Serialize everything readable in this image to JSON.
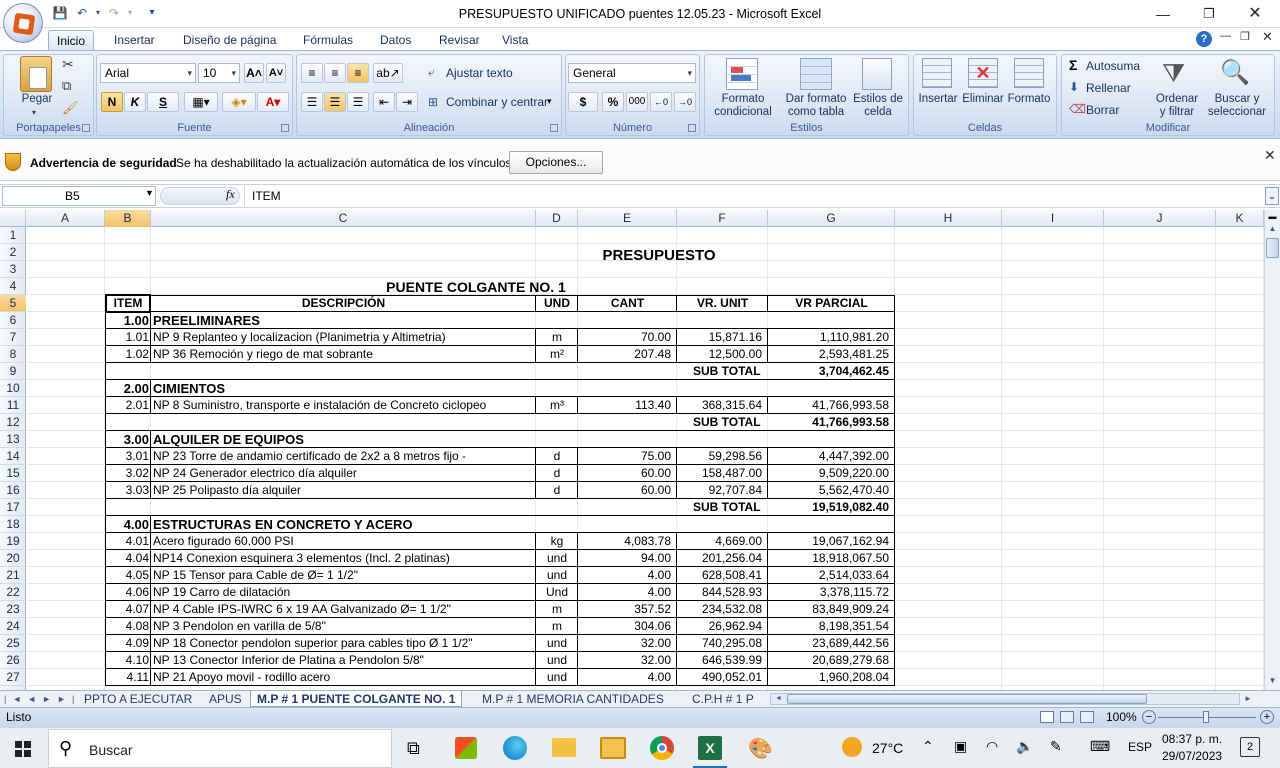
{
  "window": {
    "title": "PRESUPUESTO UNIFICADO puentes 12.05.23 - Microsoft Excel"
  },
  "ribbon": {
    "tabs": [
      "Inicio",
      "Insertar",
      "Diseño de página",
      "Fórmulas",
      "Datos",
      "Revisar",
      "Vista"
    ],
    "active_tab": "Inicio",
    "clipboard": {
      "title": "Portapapeles",
      "paste": "Pegar"
    },
    "font": {
      "title": "Fuente",
      "name": "Arial",
      "size": "10",
      "bold": "N",
      "italic": "K",
      "underline": "S"
    },
    "alignment": {
      "title": "Alineación",
      "wrap": "Ajustar texto",
      "merge": "Combinar y centrar"
    },
    "number": {
      "title": "Número",
      "format": "General",
      "currency": "$",
      "percent": "%",
      "thousands": "000"
    },
    "styles": {
      "title": "Estilos",
      "conditional": "Formato\ncondicional",
      "as_table": "Dar formato\ncomo tabla",
      "cell_styles": "Estilos de\ncelda"
    },
    "cells": {
      "title": "Celdas",
      "insert": "Insertar",
      "delete": "Eliminar",
      "format": "Formato"
    },
    "editing": {
      "title": "Modificar",
      "autosum": "Autosuma",
      "fill": "Rellenar",
      "clear": "Borrar",
      "sort": "Ordenar\ny filtrar",
      "find": "Buscar y\nseleccionar"
    }
  },
  "security": {
    "title": "Advertencia de seguridad",
    "message": "Se ha deshabilitado la actualización automática de los vínculos",
    "options": "Opciones..."
  },
  "formula_bar": {
    "name_box": "B5",
    "fx": "fx",
    "content": "ITEM"
  },
  "columns": [
    "A",
    "B",
    "C",
    "D",
    "E",
    "F",
    "G",
    "H",
    "I",
    "J",
    "K"
  ],
  "sheet": {
    "title": "PRESUPUESTO",
    "subtitle": "PUENTE COLGANTE NO. 1",
    "headers": {
      "item": "ITEM",
      "desc": "DESCRIPCIÓN",
      "und": "UND",
      "cant": "CANT",
      "vr_unit": "VR. UNIT",
      "vr_parcial": "VR PARCIAL"
    },
    "rows": [
      {
        "r": "1"
      },
      {
        "r": "2",
        "title": true
      },
      {
        "r": "3"
      },
      {
        "r": "4",
        "subtitle": true
      },
      {
        "r": "5",
        "header": true
      },
      {
        "r": "6",
        "item": "1.00",
        "desc": "PREELIMINARES",
        "section": true
      },
      {
        "r": "7",
        "item": "1.01",
        "desc": "NP 9 Replanteo y localizacion (Planimetria y Altimetria)",
        "und": "m",
        "cant": "70.00",
        "unit": "15,871.16",
        "parcial": "1,110,981.20"
      },
      {
        "r": "8",
        "item": "1.02",
        "desc": "NP 36 Remoción y riego de mat sobrante",
        "und": "m²",
        "cant": "207.48",
        "unit": "12,500.00",
        "parcial": "2,593,481.25"
      },
      {
        "r": "9",
        "subtotal": "SUB TOTAL",
        "parcial": "3,704,462.45"
      },
      {
        "r": "10",
        "item": "2.00",
        "desc": "CIMIENTOS",
        "section": true
      },
      {
        "r": "11",
        "item": "2.01",
        "desc": "NP 8 Suministro, transporte e instalación de Concreto ciclopeo",
        "und": "m³",
        "cant": "113.40",
        "unit": "368,315.64",
        "parcial": "41,766,993.58"
      },
      {
        "r": "12",
        "subtotal": "SUB TOTAL",
        "parcial": "41,766,993.58"
      },
      {
        "r": "13",
        "item": "3.00",
        "desc": "ALQUILER DE EQUIPOS",
        "section": true
      },
      {
        "r": "14",
        "item": "3.01",
        "desc": "NP 23 Torre de andamio certificado de 2x2 a 8 metros fijo -",
        "und": "d",
        "cant": "75.00",
        "unit": "59,298.56",
        "parcial": "4,447,392.00"
      },
      {
        "r": "15",
        "item": "3.02",
        "desc": "NP 24 Generador electrico día alquiler",
        "und": "d",
        "cant": "60.00",
        "unit": "158,487.00",
        "parcial": "9,509,220.00"
      },
      {
        "r": "16",
        "item": "3.03",
        "desc": "NP 25 Polipasto día alquiler",
        "und": "d",
        "cant": "60.00",
        "unit": "92,707.84",
        "parcial": "5,562,470.40"
      },
      {
        "r": "17",
        "subtotal": "SUB TOTAL",
        "parcial": "19,519,082.40"
      },
      {
        "r": "18",
        "item": "4.00",
        "desc": "ESTRUCTURAS EN CONCRETO Y ACERO",
        "section": true
      },
      {
        "r": "19",
        "item": "4.01",
        "desc": "Acero figurado 60.000 PSI",
        "und": "kg",
        "cant": "4,083.78",
        "unit": "4,669.00",
        "parcial": "19,067,162.94"
      },
      {
        "r": "20",
        "item": "4.04",
        "desc": "NP14 Conexion esquinera 3 elementos (Incl. 2 platinas)",
        "und": "und",
        "cant": "94.00",
        "unit": "201,256.04",
        "parcial": "18,918,067.50"
      },
      {
        "r": "21",
        "item": "4.05",
        "desc": "NP 15 Tensor para Cable de Ø= 1 1/2\"",
        "und": "und",
        "cant": "4.00",
        "unit": "628,508.41",
        "parcial": "2,514,033.64"
      },
      {
        "r": "22",
        "item": "4.06",
        "desc": "NP 19 Carro de dilatación",
        "und": "Und",
        "cant": "4.00",
        "unit": "844,528.93",
        "parcial": "3,378,115.72"
      },
      {
        "r": "23",
        "item": "4.07",
        "desc": "NP 4 Cable IPS-IWRC 6 x 19 AA Galvanizado Ø= 1 1/2\"",
        "und": "m",
        "cant": "357.52",
        "unit": "234,532.08",
        "parcial": "83,849,909.24"
      },
      {
        "r": "24",
        "item": "4.08",
        "desc": "NP 3 Pendolon en varilla de 5/8\"",
        "und": "m",
        "cant": "304.06",
        "unit": "26,962.94",
        "parcial": "8,198,351.54"
      },
      {
        "r": "25",
        "item": "4.09",
        "desc": "NP 18 Conector pendolon superior para cables tipo Ø 1 1/2\"",
        "und": "und",
        "cant": "32.00",
        "unit": "740,295.08",
        "parcial": "23,689,442.56"
      },
      {
        "r": "26",
        "item": "4.10",
        "desc": "NP 13 Conector Inferior de Platina a Pendolon 5/8\"",
        "und": "und",
        "cant": "32.00",
        "unit": "646,539.99",
        "parcial": "20,689,279.68"
      },
      {
        "r": "27",
        "item": "4.11",
        "desc": "NP 21 Apoyo movil - rodillo acero",
        "und": "und",
        "cant": "4.00",
        "unit": "490,052.01",
        "parcial": "1,960,208.04"
      }
    ]
  },
  "sheet_tabs": [
    "PPTO A EJECUTAR",
    "APUS",
    "M.P # 1 PUENTE COLGANTE NO. 1",
    "M.P # 1 MEMORIA CANTIDADES",
    "C.P.H # 1 P"
  ],
  "active_sheet": "M.P # 1 PUENTE COLGANTE NO. 1",
  "status": {
    "text": "Listo",
    "zoom": "100%"
  },
  "taskbar": {
    "search": "Buscar",
    "weather": "27°C",
    "lang": "ESP",
    "time": "08:37 p. m.",
    "date": "29/07/2023",
    "notifications": "2"
  }
}
